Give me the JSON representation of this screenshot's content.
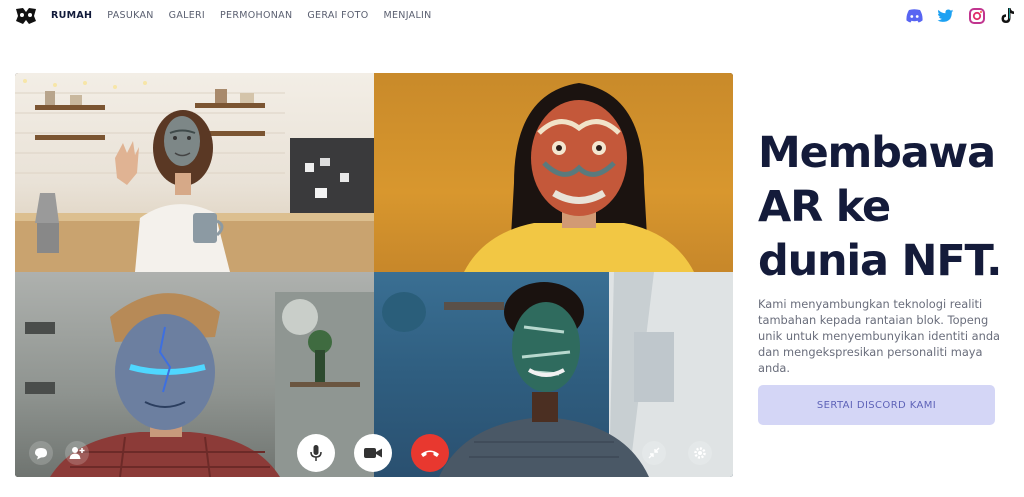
{
  "nav": {
    "links": [
      "RUMAH",
      "PASUKAN",
      "GALERI",
      "PERMOHONAN",
      "GERAI FOTO",
      "MENJALIN"
    ],
    "active_index": 0
  },
  "socials": [
    "discord-icon",
    "twitter-icon",
    "instagram-icon",
    "tiktok-icon"
  ],
  "hero": {
    "headline_lines": [
      "Membawa",
      "AR ke",
      "dunia NFT."
    ],
    "description": "Kami menyambungkan teknologi realiti tambahan kepada rantaian blok. Topeng unik untuk menyembunyikan identiti anda dan mengekspresikan personaliti maya anda.",
    "cta_label": "SERTAI DISCORD KAMI"
  },
  "call_controls": [
    "chat-icon",
    "add-user-icon",
    "microphone-icon",
    "video-camera-icon",
    "end-call-icon",
    "minimize-icon",
    "settings-icon"
  ],
  "colors": {
    "headline": "#141b3a",
    "cta_bg": "#d4d6f6",
    "cta_text": "#5e63b8",
    "end_call": "#e8382f"
  }
}
